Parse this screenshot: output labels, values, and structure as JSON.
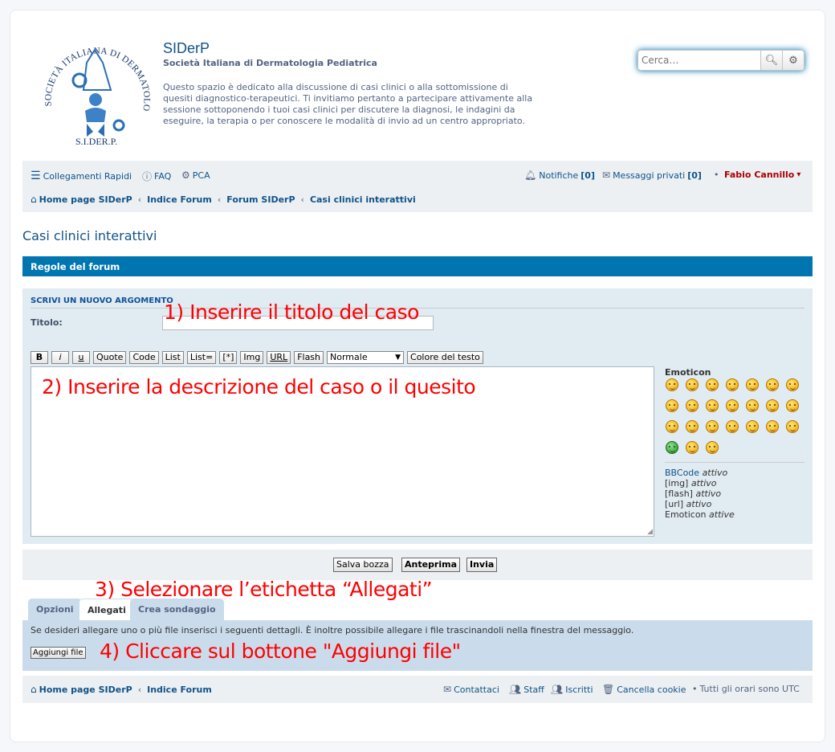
{
  "header": {
    "logo_text": "SOCIETÀ ITALIANA DI DERMATOLOGIA PEDIATRICA",
    "logo_abbr": "S.I.DER.P.",
    "site_name": "SIDerP",
    "site_sub": "Società Italiana di Dermatologia Pediatrica",
    "description": "Questo spazio è dedicato alla discussione di casi clinici o alla sottomissione di quesiti diagnostico-terapeutici. Ti invitiamo pertanto a partecipare attivamente alla sessione sottoponendo i tuoi casi clinici per discutere la diagnosi, le indagini da eseguire, la terapia o per conoscere le modalità di invio ad un centro appropriato."
  },
  "search": {
    "placeholder": "Cerca…"
  },
  "nav": {
    "quick_links": "Collegamenti Rapidi",
    "faq": "FAQ",
    "pca": "PCA",
    "notifications": "Notifiche",
    "notifications_count": "[0]",
    "messages": "Messaggi privati",
    "messages_count": "[0]",
    "user": "Fabio Cannillo",
    "user_caret": "▾",
    "breadcrumb": [
      "Home page SIDerP",
      "Indice Forum",
      "Forum SIDerP",
      "Casi clinici interattivi"
    ]
  },
  "page_title": "Casi clinici interattivi",
  "rules_bar": "Regole del forum",
  "post": {
    "heading": "SCRIVI UN NUOVO ARGOMENTO",
    "title_label": "Titolo:",
    "bbcode_buttons": [
      "B",
      "i",
      "u",
      "Quote",
      "Code",
      "List",
      "List=",
      "[*]",
      "Img",
      "URL",
      "Flash"
    ],
    "font_size": "Normale",
    "color_button": "Colore del testo",
    "emoticon_label": "Emoticon",
    "status_lines": [
      {
        "name": "BBCode",
        "state": "attivo"
      },
      {
        "name": "[img]",
        "state": "attivo"
      },
      {
        "name": "[flash]",
        "state": "attivo"
      },
      {
        "name": "[url]",
        "state": "attivo"
      },
      {
        "name": "Emoticon",
        "state": "attive"
      }
    ]
  },
  "buttons": {
    "save_draft": "Salva bozza",
    "preview": "Anteprima",
    "submit": "Invia"
  },
  "tabs": [
    "Opzioni",
    "Allegati",
    "Crea sondaggio"
  ],
  "attachments": {
    "info": "Se desideri allegare uno o più file inserisci i seguenti dettagli. È inoltre possibile allegare i file trascinandoli nella finestra del messaggio.",
    "add_file": "Aggiungi file"
  },
  "footer": {
    "home": "Home page SIDerP",
    "index": "Indice Forum",
    "contact": "Contattaci",
    "staff": "Staff",
    "members": "Iscritti",
    "delete_cookies": "Cancella cookie",
    "timezone": "Tutti gli orari sono UTC"
  },
  "annotations": {
    "step1": "1) Inserire il titolo del caso",
    "step2": "2) Inserire la descrizione del caso o il quesito",
    "step3": "3) Selezionare l’etichetta “Allegati”",
    "step4": "4)  Cliccare sul bottone \"Aggiungi file\""
  },
  "colors": {
    "link": "#105289",
    "rules_bar": "#0076b1",
    "annotation": "#ff0000",
    "user": "#aa0000"
  }
}
